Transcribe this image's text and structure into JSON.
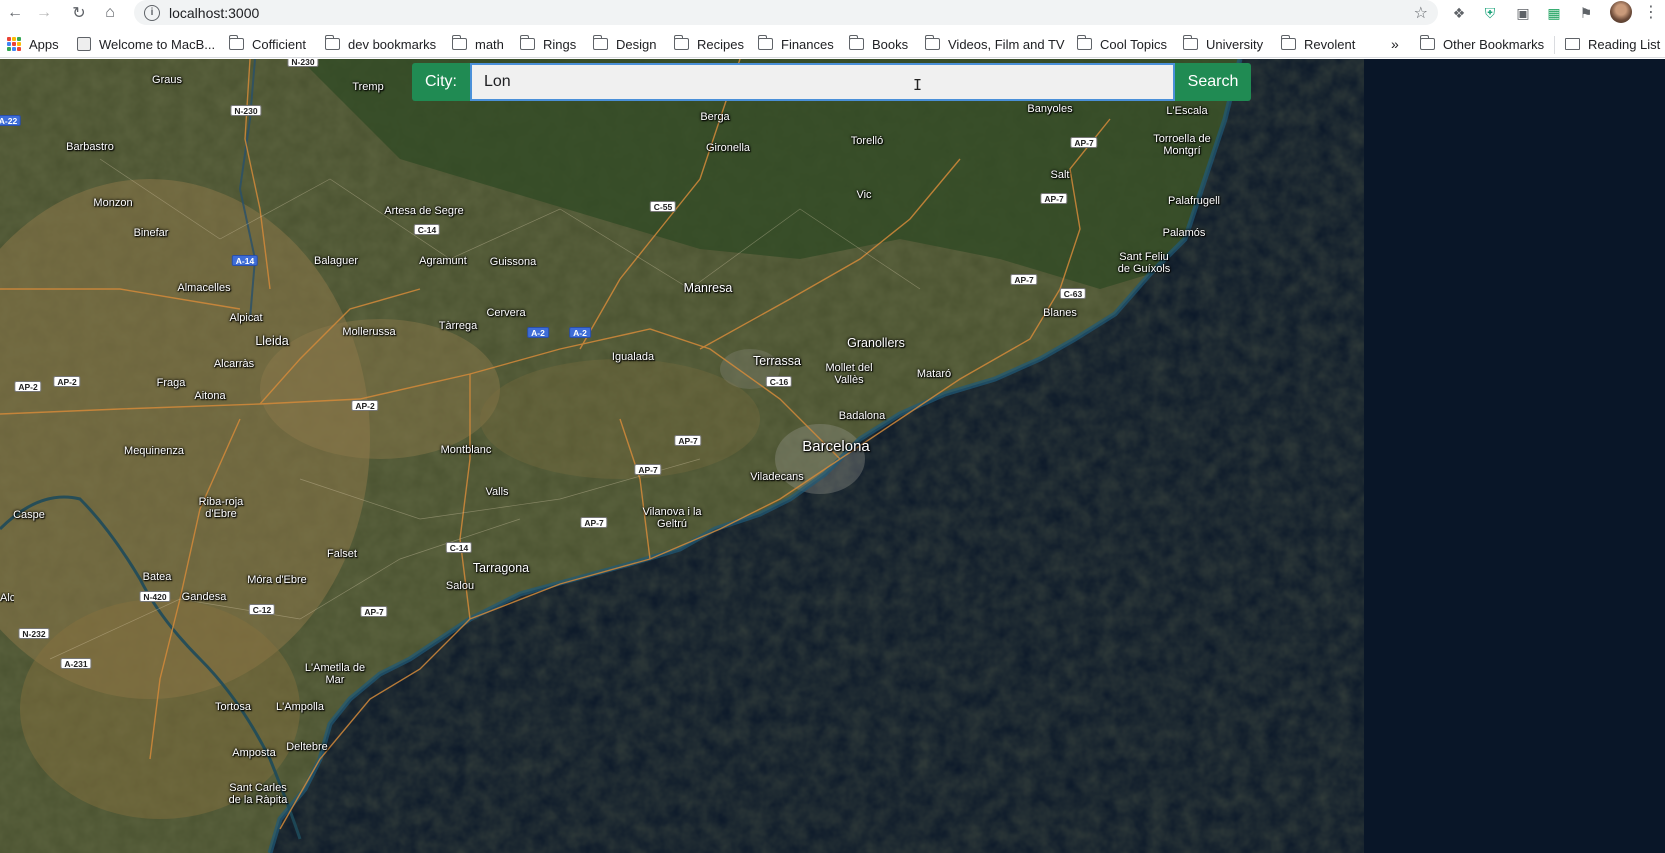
{
  "browser": {
    "url": "localhost:3000",
    "bookmarks": [
      {
        "label": "Apps",
        "icon": "apps-grid-icon"
      },
      {
        "label": "Welcome to MacB...",
        "icon": "page-icon"
      },
      {
        "label": "Cofficient",
        "icon": "folder-icon"
      },
      {
        "label": "dev bookmarks",
        "icon": "folder-icon"
      },
      {
        "label": "math",
        "icon": "folder-icon"
      },
      {
        "label": "Rings",
        "icon": "folder-icon"
      },
      {
        "label": "Design",
        "icon": "folder-icon"
      },
      {
        "label": "Recipes",
        "icon": "folder-icon"
      },
      {
        "label": "Finances",
        "icon": "folder-icon"
      },
      {
        "label": "Books",
        "icon": "folder-icon"
      },
      {
        "label": "Videos, Film and TV",
        "icon": "folder-icon"
      },
      {
        "label": "Cool Topics",
        "icon": "folder-icon"
      },
      {
        "label": "University",
        "icon": "folder-icon"
      },
      {
        "label": "Revolent",
        "icon": "folder-icon"
      }
    ],
    "overflow_label": "»",
    "other_bookmarks": "Other Bookmarks",
    "reading_list": "Reading List"
  },
  "search": {
    "label": "City:",
    "value": "Lon",
    "button_label": "Search"
  },
  "map": {
    "places": [
      {
        "name": "Graus"
      },
      {
        "name": "Tremp"
      },
      {
        "name": "Berga"
      },
      {
        "name": "Banyoles"
      },
      {
        "name": "L'Escala"
      },
      {
        "name": "Barbastro"
      },
      {
        "name": "Gironella"
      },
      {
        "name": "Torelló"
      },
      {
        "name": "Torroella de Montgrí"
      },
      {
        "name": "Monzon"
      },
      {
        "name": "Salt"
      },
      {
        "name": "Vic"
      },
      {
        "name": "Artesa de Segre"
      },
      {
        "name": "Palafrugell"
      },
      {
        "name": "Binefar"
      },
      {
        "name": "Palamós"
      },
      {
        "name": "Balaguer"
      },
      {
        "name": "Agramunt"
      },
      {
        "name": "Guissona"
      },
      {
        "name": "Sant Feliu de Guíxols"
      },
      {
        "name": "Almacelles"
      },
      {
        "name": "Manresa"
      },
      {
        "name": "Cervera"
      },
      {
        "name": "Alpicat"
      },
      {
        "name": "Tàrrega"
      },
      {
        "name": "Blanes"
      },
      {
        "name": "Mollerussa"
      },
      {
        "name": "Lleida"
      },
      {
        "name": "Igualada"
      },
      {
        "name": "Granollers"
      },
      {
        "name": "Alcarràs"
      },
      {
        "name": "Terrassa"
      },
      {
        "name": "Mollet del Vallès"
      },
      {
        "name": "Mataró"
      },
      {
        "name": "Fraga"
      },
      {
        "name": "Aitona"
      },
      {
        "name": "Badalona"
      },
      {
        "name": "Barcelona"
      },
      {
        "name": "Mequinenza"
      },
      {
        "name": "Montblanc"
      },
      {
        "name": "Viladecans"
      },
      {
        "name": "Valls"
      },
      {
        "name": "Caspe"
      },
      {
        "name": "Riba-roja d'Ebre"
      },
      {
        "name": "Vilanova i la Geltrú"
      },
      {
        "name": "Falset"
      },
      {
        "name": "Tarragona"
      },
      {
        "name": "Batea"
      },
      {
        "name": "Móra d'Ebre"
      },
      {
        "name": "Salou"
      },
      {
        "name": "Gandesa"
      },
      {
        "name": "L'Ametlla de Mar"
      },
      {
        "name": "Tortosa"
      },
      {
        "name": "L'Ampolla"
      },
      {
        "name": "Amposta"
      },
      {
        "name": "Deltebre"
      },
      {
        "name": "Sant Carles de la Ràpita"
      },
      {
        "name": "Alcañiz"
      }
    ],
    "roads": [
      {
        "ref": "N-230"
      },
      {
        "ref": "N-230"
      },
      {
        "ref": "A-22"
      },
      {
        "ref": "AP-7"
      },
      {
        "ref": "AP-7"
      },
      {
        "ref": "C-55"
      },
      {
        "ref": "C-14"
      },
      {
        "ref": "A-14"
      },
      {
        "ref": "AP-7"
      },
      {
        "ref": "C-63"
      },
      {
        "ref": "A-2"
      },
      {
        "ref": "A-2"
      },
      {
        "ref": "AP-2"
      },
      {
        "ref": "AP-2"
      },
      {
        "ref": "C-16"
      },
      {
        "ref": "AP-2"
      },
      {
        "ref": "AP-7"
      },
      {
        "ref": "AP-7"
      },
      {
        "ref": "AP-7"
      },
      {
        "ref": "C-14"
      },
      {
        "ref": "N-420"
      },
      {
        "ref": "C-12"
      },
      {
        "ref": "AP-7"
      },
      {
        "ref": "N-232"
      },
      {
        "ref": "A-231"
      }
    ]
  },
  "colors": {
    "accent": "#208b53",
    "focus": "#4a90d9",
    "sea": "#091628"
  }
}
